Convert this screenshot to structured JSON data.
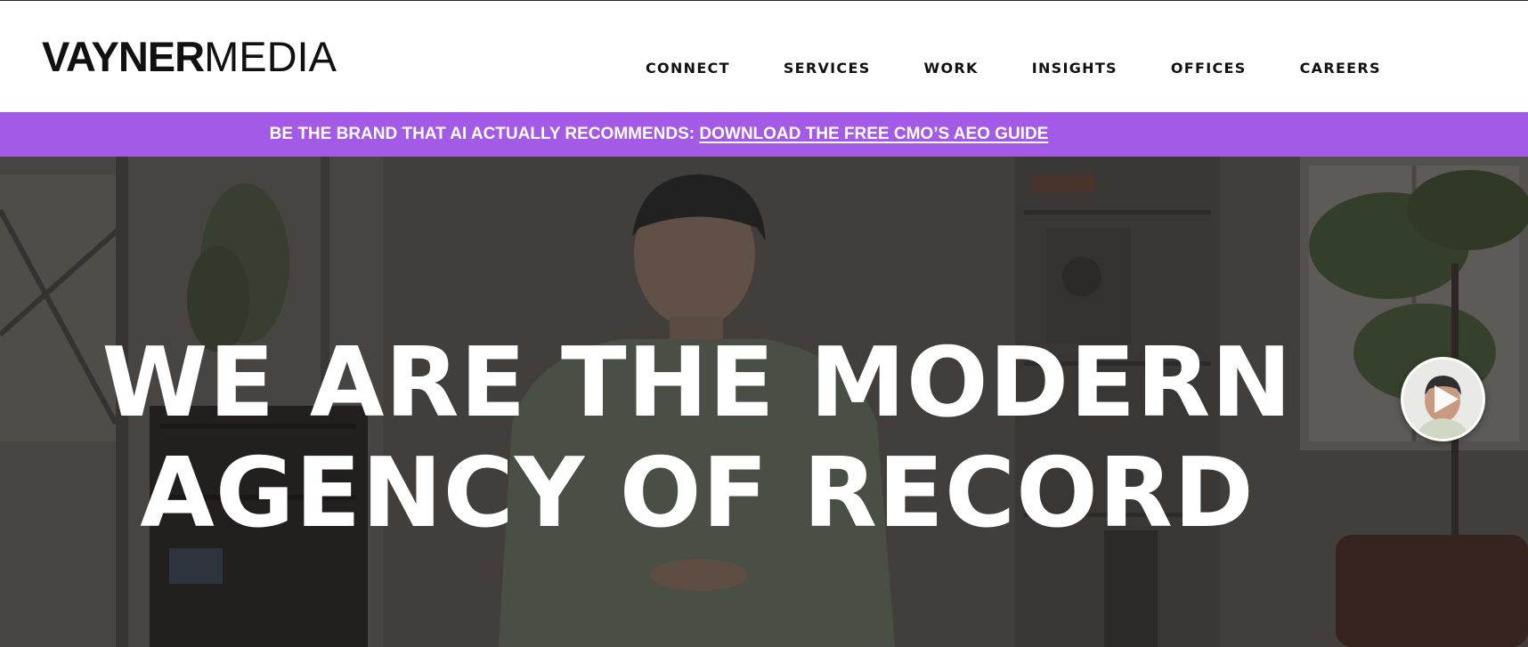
{
  "header": {
    "logo": {
      "bold": "VAYNER",
      "light": "MEDIA"
    },
    "nav": [
      {
        "label": "CONNECT"
      },
      {
        "label": "SERVICES"
      },
      {
        "label": "WORK"
      },
      {
        "label": "INSIGHTS"
      },
      {
        "label": "OFFICES"
      },
      {
        "label": "CAREERS"
      }
    ]
  },
  "promo": {
    "text": "BE THE BRAND THAT AI ACTUALLY RECOMMENDS: ",
    "link": "DOWNLOAD THE FREE CMO’S AEO GUIDE",
    "color": "#a35ae6"
  },
  "hero": {
    "title_line_1": "WE ARE THE MODERN",
    "title_line_2": "AGENCY OF RECORD"
  },
  "video_bubble": {
    "icon": "play-icon"
  }
}
